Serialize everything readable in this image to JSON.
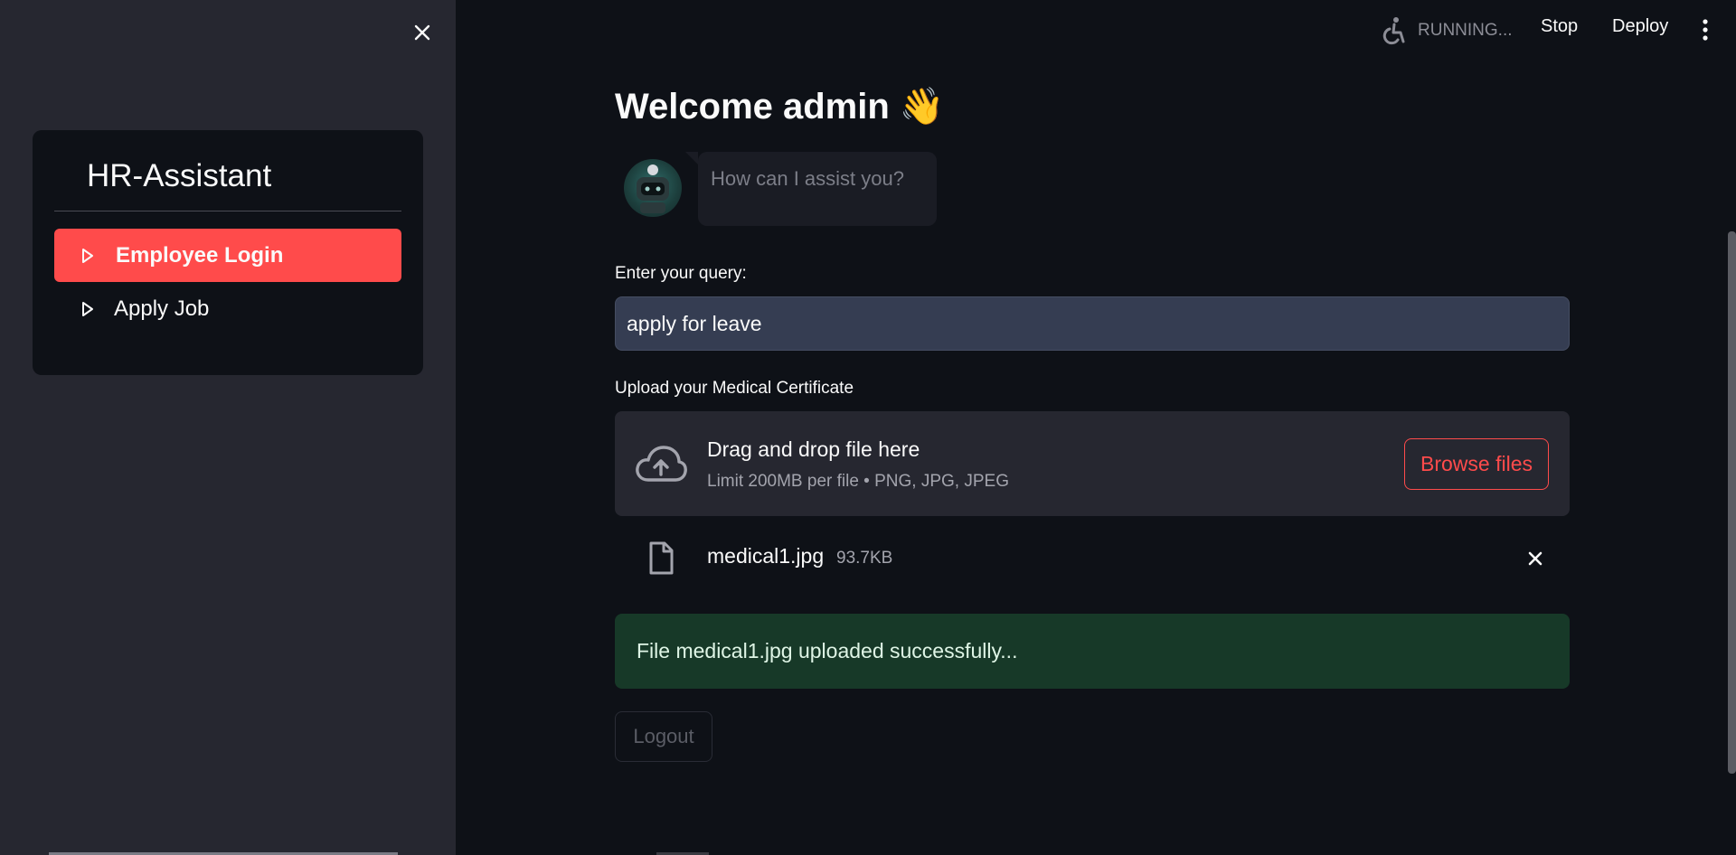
{
  "sidebar": {
    "title": "HR-Assistant",
    "items": [
      {
        "label": "Employee Login",
        "active": true
      },
      {
        "label": "Apply Job",
        "active": false
      }
    ]
  },
  "topbar": {
    "status": "RUNNING...",
    "stop_label": "Stop",
    "deploy_label": "Deploy"
  },
  "main": {
    "welcome": "Welcome admin 👋",
    "assistant_message": "How can I assist you?",
    "query_label": "Enter your query:",
    "query_value": "apply for leave",
    "upload_label": "Upload your Medical Certificate",
    "dropzone_title": "Drag and drop file here",
    "dropzone_limits": "Limit 200MB per file • PNG, JPG, JPEG",
    "browse_label": "Browse files",
    "file": {
      "name": "medical1.jpg",
      "size": "93.7KB"
    },
    "success_message": "File medical1.jpg uploaded successfully...",
    "logout_label": "Logout"
  },
  "colors": {
    "accent": "#ff4b4b",
    "background": "#0e1117",
    "sidebar_bg": "#262730",
    "success_bg": "#173928"
  }
}
